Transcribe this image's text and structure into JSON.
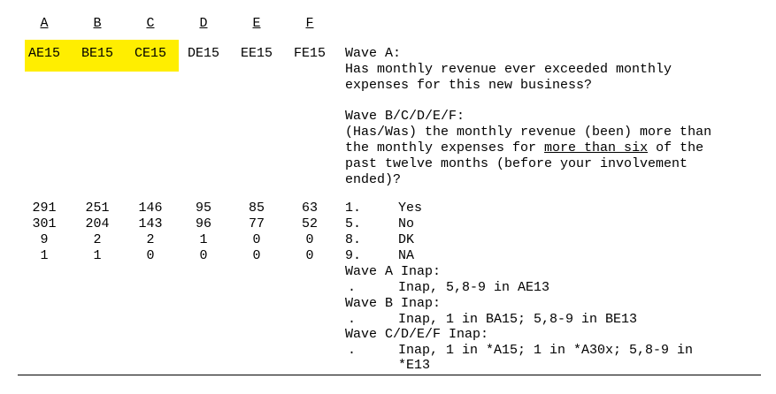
{
  "wave_headers": [
    "A",
    "B",
    "C",
    "D",
    "E",
    "F"
  ],
  "variables": [
    "AE15",
    "BE15",
    "CE15",
    "DE15",
    "EE15",
    "FE15"
  ],
  "highlight_color": "#ffee00",
  "question": {
    "wave_a_label": "Wave A:",
    "wave_a_text": [
      "Has monthly revenue ever exceeded monthly",
      "expenses for this new business?"
    ],
    "wave_bf_label": "Wave B/C/D/E/F:",
    "wave_bf_line1": "(Has/Was) the monthly revenue (been) more than",
    "wave_bf_line2_pre": "the monthly expenses for ",
    "wave_bf_line2_underlined": "more than six",
    "wave_bf_line2_post": " of the",
    "wave_bf_line3": "past twelve months (before your involvement",
    "wave_bf_line4": "ended)?"
  },
  "responses": [
    {
      "code": "1.",
      "label": "Yes",
      "counts": [
        "291",
        "251",
        "146",
        "95",
        "85",
        "63"
      ]
    },
    {
      "code": "5.",
      "label": "No",
      "counts": [
        "301",
        "204",
        "143",
        "96",
        "77",
        "52"
      ]
    },
    {
      "code": "8.",
      "label": "DK",
      "counts": [
        "9",
        "2",
        "2",
        "1",
        "0",
        "0"
      ]
    },
    {
      "code": "9.",
      "label": "NA",
      "counts": [
        "1",
        "1",
        "0",
        "0",
        "0",
        "0"
      ]
    }
  ],
  "inap": [
    {
      "label": "Wave A Inap:",
      "dot": ".",
      "lines": [
        "Inap, 5,8-9 in AE13"
      ]
    },
    {
      "label": "Wave B Inap:",
      "dot": ".",
      "lines": [
        "Inap, 1 in BA15; 5,8-9 in BE13"
      ]
    },
    {
      "label": "Wave C/D/E/F Inap:",
      "dot": ".",
      "lines": [
        "Inap, 1 in *A15; 1 in *A30x; 5,8-9 in",
        "*E13"
      ]
    }
  ]
}
